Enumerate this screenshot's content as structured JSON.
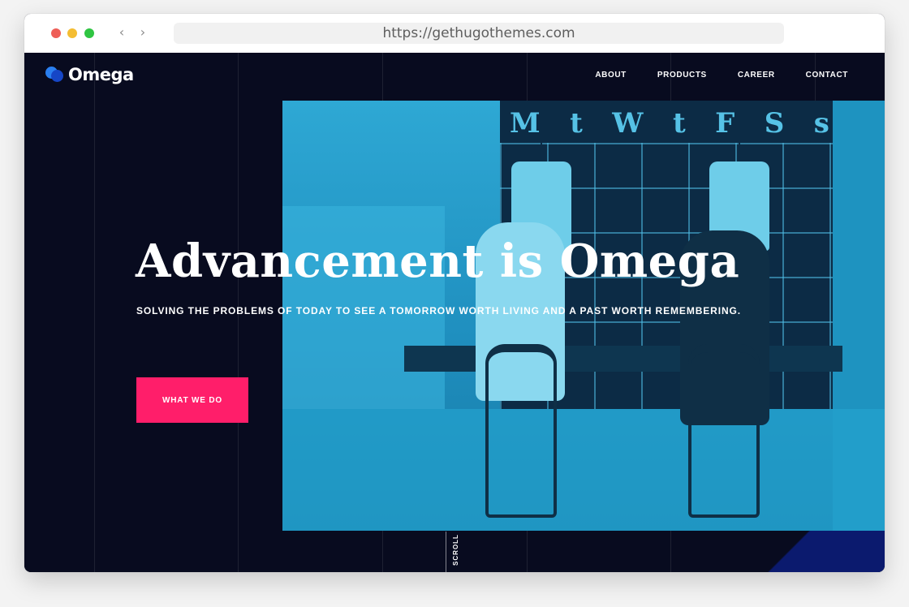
{
  "browser": {
    "url": "https://gethugothemes.com",
    "back_icon": "chevron-left-icon",
    "forward_icon": "chevron-right-icon"
  },
  "site": {
    "logo_text": "Omega",
    "nav": [
      {
        "label": "ABOUT"
      },
      {
        "label": "PRODUCTS"
      },
      {
        "label": "CAREER"
      },
      {
        "label": "CONTACT"
      }
    ]
  },
  "hero": {
    "title": "Advancement is Omega",
    "subtitle": "SOLVING THE PROBLEMS OF TODAY TO SEE A TOMORROW WORTH LIVING AND A PAST WORTH REMEMBERING.",
    "cta_label": "WHAT WE DO",
    "scroll_label": "SCROLL",
    "board_days": [
      "M",
      "t",
      "W",
      "t",
      "F",
      "S",
      "s"
    ]
  },
  "colors": {
    "page_bg": "#080b1f",
    "accent": "#ff1e6a",
    "photo_tint": "#1f8fbf",
    "logo_blue": "#2a7ff0"
  }
}
